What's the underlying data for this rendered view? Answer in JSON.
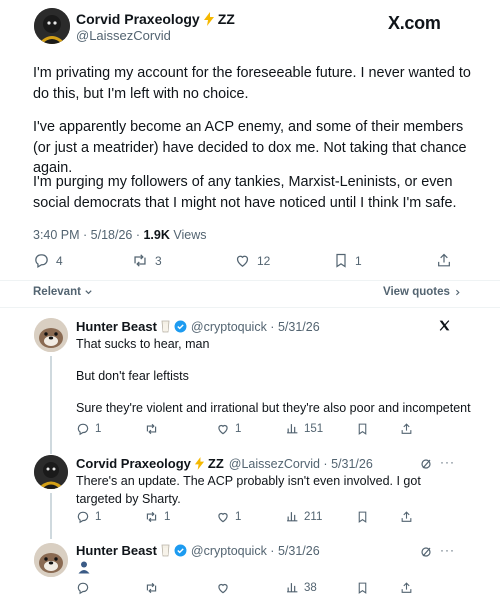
{
  "post": {
    "display_name": "Corvid Praxeology",
    "name_suffix": "ZZ",
    "handle": "@LaissezCorvid",
    "site_label": "X.com",
    "paragraphs": [
      "I'm privating my account for the foreseeable future. I never wanted to do this, but I'm left with no choice.",
      "I've apparently become an ACP enemy, and some of their members (or just a meatrider) have decided to dox me. Not taking that chance again.",
      "I'm purging my followers of any tankies, Marxist-Leninists, or even social democrats that I might not have noticed until I think I'm safe."
    ],
    "meta_time": "3:40 PM · 5/18/26 · ",
    "views_count": "1.9K",
    "views_label": " Views",
    "replies": "4",
    "reposts": "3",
    "likes": "12",
    "bookmarks": "1"
  },
  "filter": {
    "relevant_label": "Relevant",
    "view_quotes_label": "View quotes"
  },
  "replies": [
    {
      "display_name": "Hunter Beast",
      "handle_date": "@cryptoquick · 5/31/26",
      "lines": [
        "That sucks to hear, man",
        "But don't fear leftists",
        "Sure they're violent and irrational but they're also poor and incompetent"
      ],
      "replies": "1",
      "reposts": "",
      "likes": "1",
      "views": "151"
    },
    {
      "display_name": "Corvid Praxeology",
      "name_suffix": "ZZ",
      "handle_date": "@LaissezCorvid · 5/31/26",
      "lines": [
        "There's an update. The ACP probably isn't even involved. I got targeted by Sharty."
      ],
      "replies": "1",
      "reposts": "1",
      "likes": "1",
      "views": "211"
    },
    {
      "display_name": "Hunter Beast",
      "handle_date": "@cryptoquick · 5/31/26",
      "lines": [],
      "replies": "",
      "reposts": "",
      "likes": "",
      "views": "38"
    }
  ],
  "colors": {
    "text": "#0f1419",
    "secondary": "#536471",
    "verified": "#1d9bf0",
    "lightning": "#f5b800",
    "divider": "#eff3f4"
  }
}
